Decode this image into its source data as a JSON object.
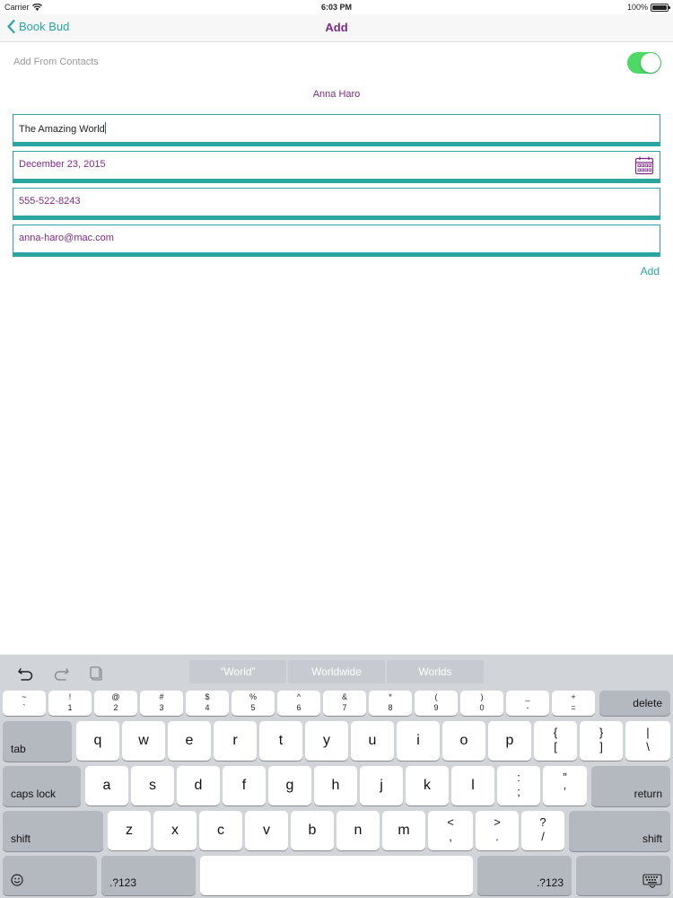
{
  "status_bar": {
    "carrier": "Carrier",
    "time": "6:03 PM",
    "battery": "100%"
  },
  "nav": {
    "back_label": "Book Bud",
    "title": "Add"
  },
  "form": {
    "add_from_contacts_label": "Add From Contacts",
    "add_from_contacts_on": true,
    "contact_name": "Anna Haro",
    "title_value": "The Amazing World",
    "date_value": "December 23, 2015",
    "phone_value": "555-522-8243",
    "email_value": "anna-haro@mac.com",
    "add_button": "Add"
  },
  "keyboard": {
    "suggestions": [
      "“World”",
      "Worldwide",
      "Worlds"
    ],
    "number_row": [
      {
        "top": "~",
        "bottom": "`"
      },
      {
        "top": "!",
        "bottom": "1"
      },
      {
        "top": "@",
        "bottom": "2"
      },
      {
        "top": "#",
        "bottom": "3"
      },
      {
        "top": "$",
        "bottom": "4"
      },
      {
        "top": "%",
        "bottom": "5"
      },
      {
        "top": "^",
        "bottom": "6"
      },
      {
        "top": "&",
        "bottom": "7"
      },
      {
        "top": "*",
        "bottom": "8"
      },
      {
        "top": "(",
        "bottom": "9"
      },
      {
        "top": ")",
        "bottom": "0"
      },
      {
        "top": "_",
        "bottom": "-"
      },
      {
        "top": "+",
        "bottom": "="
      }
    ],
    "delete": "delete",
    "tab": "tab",
    "row1": [
      "q",
      "w",
      "e",
      "r",
      "t",
      "y",
      "u",
      "i",
      "o",
      "p"
    ],
    "row1_symbols": [
      {
        "top": "{",
        "bottom": "["
      },
      {
        "top": "}",
        "bottom": "]"
      },
      {
        "top": "|",
        "bottom": "\\"
      }
    ],
    "caps_lock": "caps lock",
    "row2": [
      "a",
      "s",
      "d",
      "f",
      "g",
      "h",
      "j",
      "k",
      "l"
    ],
    "row2_symbols": [
      {
        "top": ":",
        "bottom": ";"
      },
      {
        "top": "”",
        "bottom": "’"
      }
    ],
    "return": "return",
    "shift": "shift",
    "row3": [
      "z",
      "x",
      "c",
      "v",
      "b",
      "n",
      "m"
    ],
    "row3_symbols": [
      {
        "top": "<",
        "bottom": ","
      },
      {
        "top": ">",
        "bottom": "."
      },
      {
        "top": "?",
        "bottom": "/"
      }
    ],
    "numbers_key": ".?123",
    "emoji_icon": "smiley-icon",
    "dismiss_icon": "keyboard-dismiss-icon"
  },
  "colors": {
    "teal": "#2aa5a0",
    "purple": "#7d2a86",
    "toggle_green": "#4cd964"
  }
}
